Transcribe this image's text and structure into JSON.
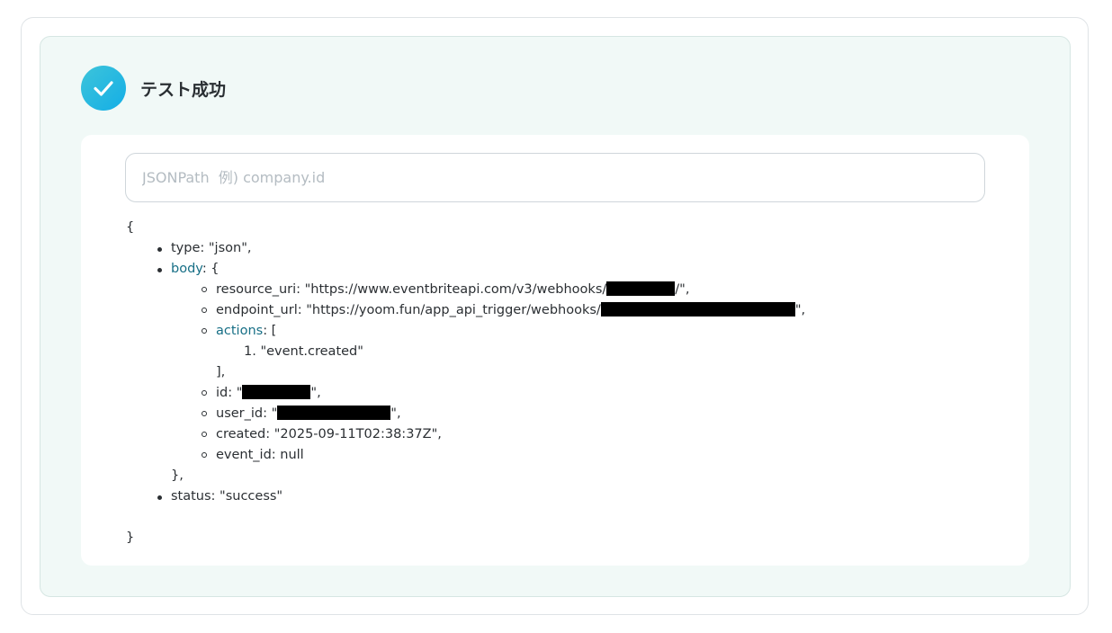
{
  "header": {
    "title": "テスト成功",
    "icon": "check-circle-icon",
    "accent": "#1fb8e0"
  },
  "search": {
    "placeholder": "JSONPath  例) company.id",
    "value": ""
  },
  "json": {
    "open_brace": "{",
    "close_brace": "}",
    "type_line": "type: \"json\",",
    "body_key": "body",
    "body_open": ": {",
    "resource_uri_prefix": "resource_uri: \"https://www.eventbriteapi.com/v3/webhooks/",
    "resource_uri_suffix": "/\",",
    "endpoint_url_prefix": "endpoint_url: \"https://yoom.fun/app_api_trigger/webhooks/",
    "endpoint_url_suffix": "\",",
    "actions_key": "actions",
    "actions_open": ": [",
    "action_item": "1. \"event.created\"",
    "actions_close": "],",
    "id_prefix": "id: \"",
    "id_suffix": "\",",
    "user_id_prefix": "user_id: \"",
    "user_id_suffix": "\",",
    "created_line": "created: \"2025-09-11T02:38:37Z\",",
    "event_id_line": "event_id: null",
    "body_close": "},",
    "status_line": "status: \"success\""
  }
}
